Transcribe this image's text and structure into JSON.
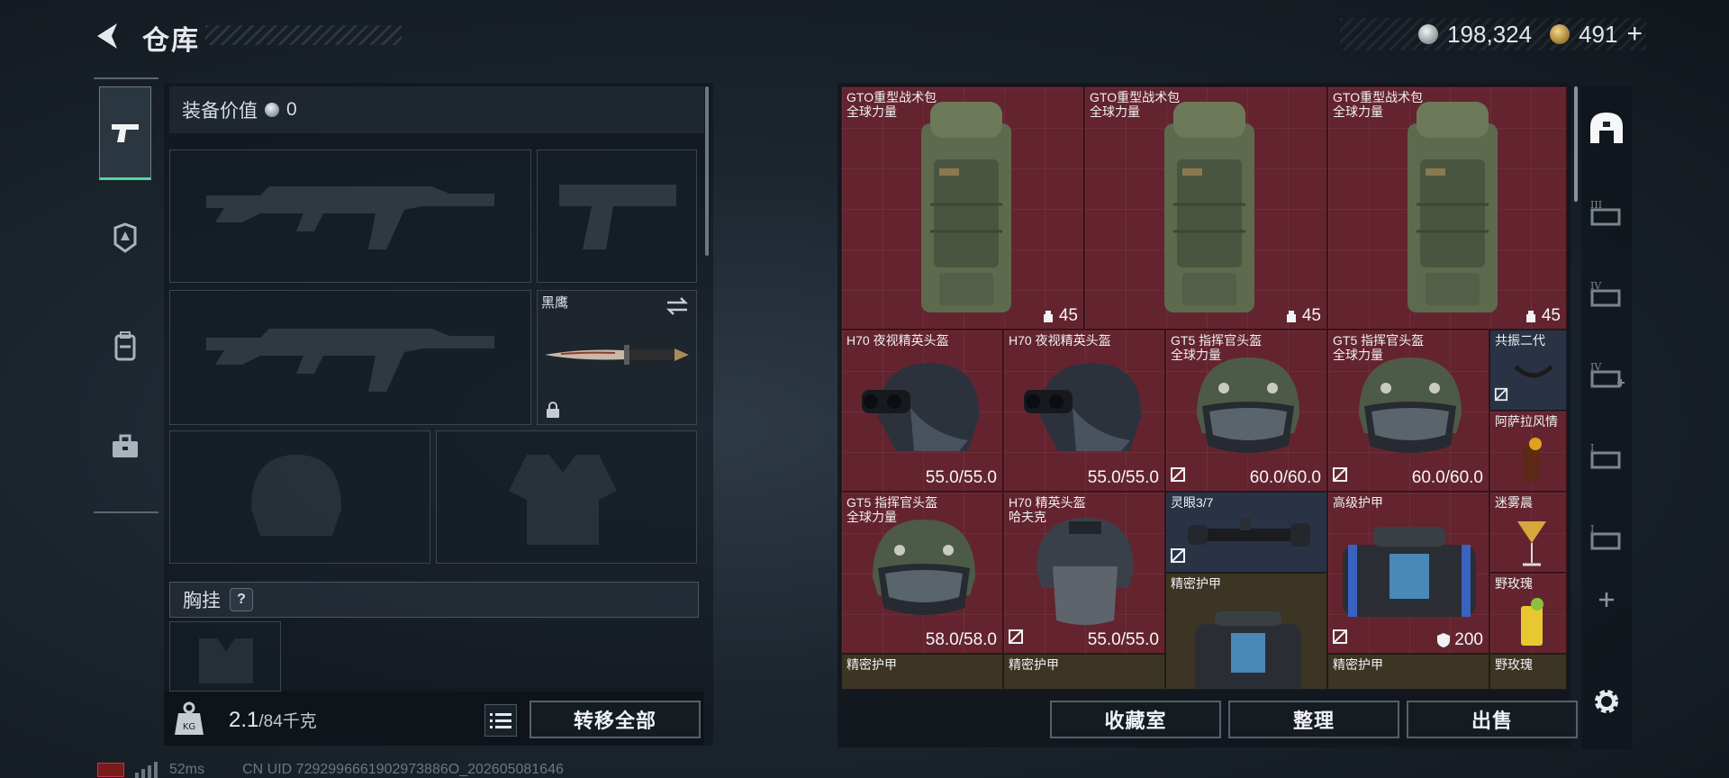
{
  "header": {
    "title": "仓库"
  },
  "currency": {
    "silver": "198,324",
    "gold": "491",
    "add_label": "+"
  },
  "left_tabs": [
    "pistol-icon",
    "armor-badge-icon",
    "backpack-icon",
    "toolbox-icon"
  ],
  "equipment": {
    "value_label": "装备价值",
    "value": "0",
    "knife": {
      "name": "黑鹰"
    },
    "chest_rig_label": "胸挂",
    "help_label": "?"
  },
  "weight": {
    "current": "2.1",
    "capacity": "/84千克"
  },
  "buttons": {
    "transfer_all": "转移全部",
    "collection_room": "收藏室",
    "organize": "整理",
    "sell": "出售"
  },
  "status": {
    "ping": "52ms",
    "uid": "CN UID 7292996661902973886O_202605081646"
  },
  "storage": {
    "items": [
      {
        "name": "GTO重型战术包",
        "sub": "全球力量",
        "value": "45"
      },
      {
        "name": "GTO重型战术包",
        "sub": "全球力量",
        "value": "45"
      },
      {
        "name": "GTO重型战术包",
        "sub": "全球力量",
        "value": "45"
      },
      {
        "name": "H70 夜视精英头盔",
        "sub": "",
        "value": "55.0/55.0"
      },
      {
        "name": "H70 夜视精英头盔",
        "sub": "",
        "value": "55.0/55.0"
      },
      {
        "name": "GT5 指挥官头盔",
        "sub": "全球力量",
        "value": "60.0/60.0"
      },
      {
        "name": "GT5 指挥官头盔",
        "sub": "全球力量",
        "value": "60.0/60.0"
      },
      {
        "name": "共振二代",
        "sub": "",
        "value": ""
      },
      {
        "name": "阿萨拉风情",
        "sub": "",
        "value": ""
      },
      {
        "name": "GT5 指挥官头盔",
        "sub": "全球力量",
        "value": "58.0/58.0"
      },
      {
        "name": "H70 精英头盔",
        "sub": "哈夫克",
        "value": "55.0/55.0"
      },
      {
        "name": "灵眼3/7",
        "sub": "",
        "value": ""
      },
      {
        "name": "精密护甲",
        "sub": "",
        "value": ""
      },
      {
        "name": "高级护甲",
        "sub": "",
        "value": "200"
      },
      {
        "name": "迷雾晨",
        "sub": "",
        "value": ""
      },
      {
        "name": "野玫瑰",
        "sub": "",
        "value": ""
      },
      {
        "name": "精密护甲",
        "sub": "",
        "value": ""
      },
      {
        "name": "精密护甲",
        "sub": "",
        "value": ""
      },
      {
        "name": "精密护甲",
        "sub": "",
        "value": ""
      },
      {
        "name": "野玫瑰",
        "sub": "",
        "value": ""
      }
    ]
  },
  "right_tabs": [
    "home-base-icon",
    "storage-III-icon",
    "storage-IV-icon",
    "storage-IV-plus-icon",
    "storage-I-icon",
    "storage-I-alt-icon",
    "add-icon",
    "settings-icon"
  ],
  "colors": {
    "rare_red": "#64242f",
    "epic_blue": "#2a3346",
    "accent_green": "#54d6a0"
  }
}
